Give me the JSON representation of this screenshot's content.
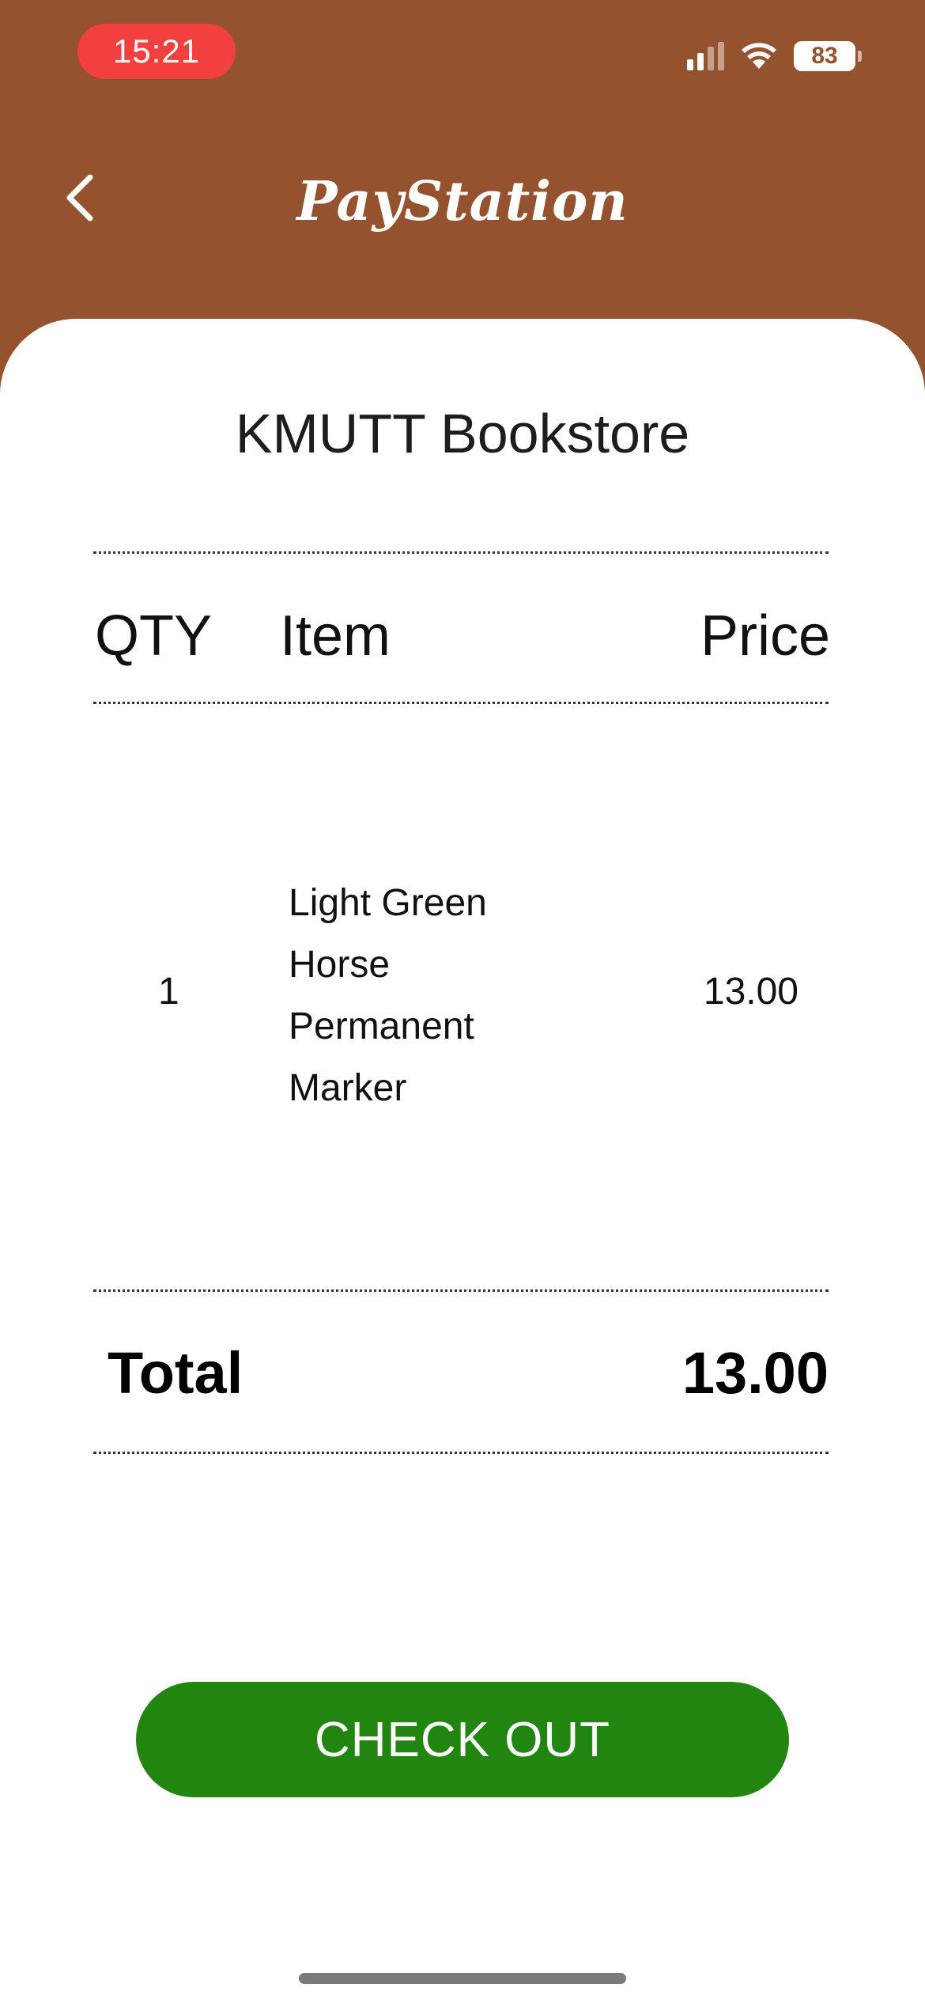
{
  "status_bar": {
    "time": "15:21",
    "battery": "83",
    "icons": [
      "signal-icon",
      "wifi-icon",
      "battery-icon"
    ]
  },
  "header": {
    "title": "PayStation",
    "back_icon": "chevron-left-icon"
  },
  "receipt": {
    "store_name": "KMUTT Bookstore",
    "columns": {
      "qty": "QTY",
      "item": "Item",
      "price": "Price"
    },
    "items": [
      {
        "qty": "1",
        "item_lines": [
          "Light Green",
          "Horse",
          "Permanent",
          "Marker"
        ],
        "price": "13.00"
      }
    ],
    "total_label": "Total",
    "total_value": "13.00"
  },
  "actions": {
    "checkout_label": "CHECK OUT"
  },
  "colors": {
    "header_bg": "#95522f",
    "time_pill": "#f2403f",
    "checkout_bg": "#21860f",
    "card_bg": "#ffffff"
  }
}
